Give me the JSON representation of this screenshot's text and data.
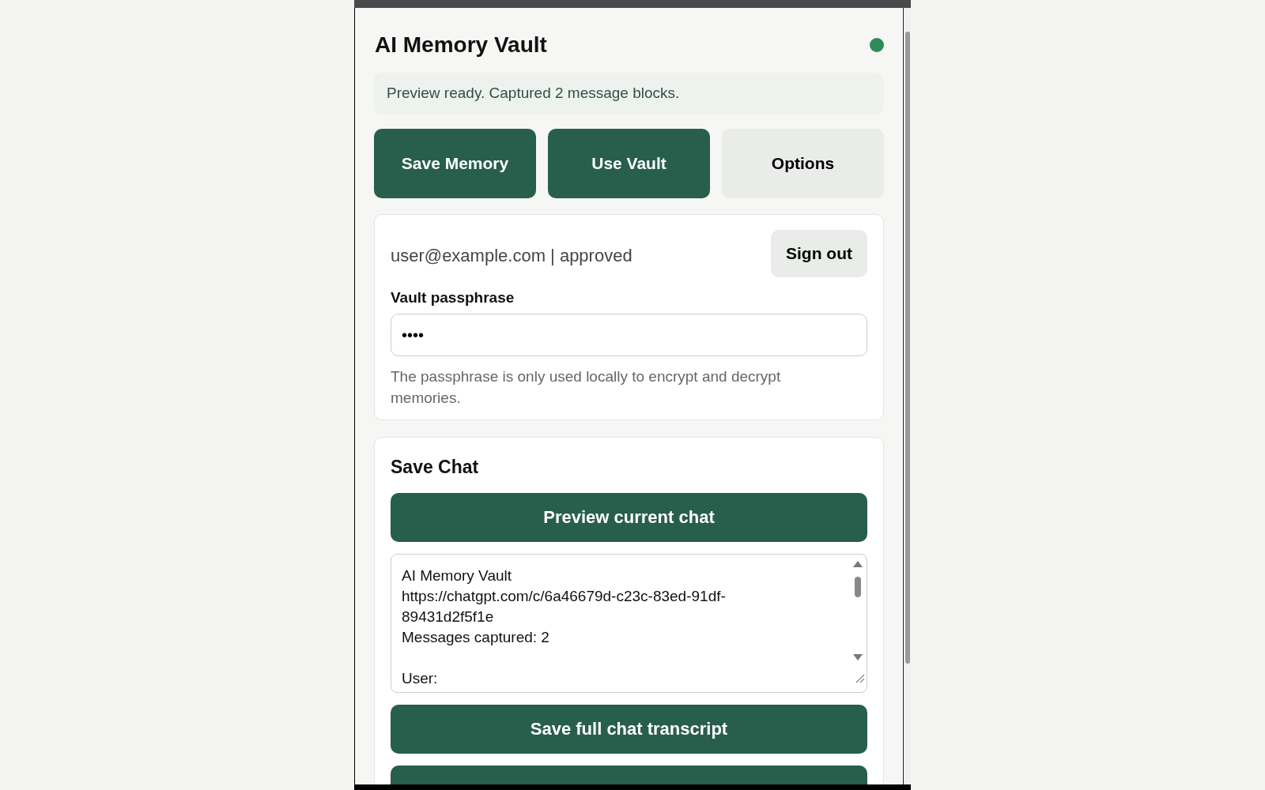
{
  "header": {
    "title": "AI Memory Vault",
    "online": true
  },
  "status_message": "Preview ready. Captured 2 message blocks.",
  "nav_buttons": [
    {
      "label": "Save Memory",
      "kind": "primary"
    },
    {
      "label": "Use Vault",
      "kind": "primary"
    },
    {
      "label": "Options",
      "kind": "secondary"
    }
  ],
  "account": {
    "user_line": "user@example.com | approved",
    "sign_out": "Sign out",
    "passphrase_label": "Vault passphrase",
    "passphrase_value": "••••",
    "help": "The passphrase is only used locally to encrypt and decrypt memories."
  },
  "save_chat": {
    "title": "Save Chat",
    "preview_button": "Preview current chat",
    "preview_lines": [
      {
        "text": "AI Memory Vault",
        "blank_before": false
      },
      {
        "text": "https://chatgpt.com/c/6a46679d-c23c-83ed-91df-89431d2f5f1e",
        "blank_before": false
      },
      {
        "text": "Messages captured: 2",
        "blank_before": false
      },
      {
        "text": "User:",
        "blank_before": true
      }
    ],
    "save_button": "Save full chat transcript"
  }
}
